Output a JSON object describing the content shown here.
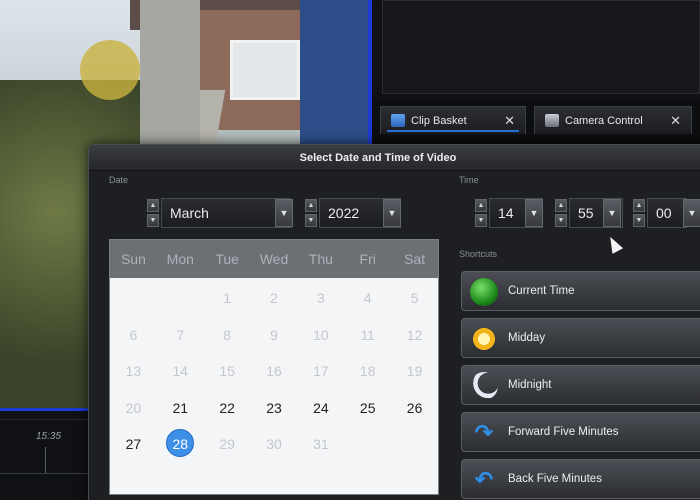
{
  "tabs": [
    {
      "label": "Clip Basket",
      "icon": "clip-basket-icon"
    },
    {
      "label": "Camera Control",
      "icon": "camera-icon"
    }
  ],
  "close_glyph": "✕",
  "timeline": {
    "label": "15:35"
  },
  "dialog": {
    "title": "Select Date and Time of Video",
    "date_group": "Date",
    "time_group": "Time",
    "shortcuts_group": "Shortcuts",
    "month": "March",
    "year": "2022",
    "hour": "14",
    "minute": "55",
    "second": "00"
  },
  "calendar": {
    "weekdays": [
      "Sun",
      "Mon",
      "Tue",
      "Wed",
      "Thu",
      "Fri",
      "Sat"
    ],
    "selected_day": "28",
    "days": [
      {
        "t": "",
        "s": "empty"
      },
      {
        "t": "",
        "s": "empty"
      },
      {
        "t": "1",
        "s": "faded"
      },
      {
        "t": "2",
        "s": "faded"
      },
      {
        "t": "3",
        "s": "faded"
      },
      {
        "t": "4",
        "s": "faded"
      },
      {
        "t": "5",
        "s": "faded"
      },
      {
        "t": "6",
        "s": "faded"
      },
      {
        "t": "7",
        "s": "faded"
      },
      {
        "t": "8",
        "s": "faded"
      },
      {
        "t": "9",
        "s": "faded"
      },
      {
        "t": "10",
        "s": "faded"
      },
      {
        "t": "11",
        "s": "faded"
      },
      {
        "t": "12",
        "s": "faded"
      },
      {
        "t": "13",
        "s": "faded"
      },
      {
        "t": "14",
        "s": "faded"
      },
      {
        "t": "15",
        "s": "faded"
      },
      {
        "t": "16",
        "s": "faded"
      },
      {
        "t": "17",
        "s": "faded"
      },
      {
        "t": "18",
        "s": "faded"
      },
      {
        "t": "19",
        "s": "faded"
      },
      {
        "t": "20",
        "s": "faded"
      },
      {
        "t": "21",
        "s": "normal"
      },
      {
        "t": "22",
        "s": "normal"
      },
      {
        "t": "23",
        "s": "normal"
      },
      {
        "t": "24",
        "s": "normal"
      },
      {
        "t": "25",
        "s": "normal"
      },
      {
        "t": "26",
        "s": "normal"
      },
      {
        "t": "27",
        "s": "normal"
      },
      {
        "t": "28",
        "s": "selected"
      },
      {
        "t": "29",
        "s": "faded"
      },
      {
        "t": "30",
        "s": "faded"
      },
      {
        "t": "31",
        "s": "faded"
      },
      {
        "t": "",
        "s": "empty"
      },
      {
        "t": "",
        "s": "empty"
      }
    ]
  },
  "shortcuts": [
    {
      "label": "Current Time",
      "icon": "green-orb-icon"
    },
    {
      "label": "Midday",
      "icon": "sun-icon"
    },
    {
      "label": "Midnight",
      "icon": "moon-icon"
    },
    {
      "label": "Forward Five Minutes",
      "icon": "forward-arrow-icon"
    },
    {
      "label": "Back Five Minutes",
      "icon": "back-arrow-icon"
    }
  ],
  "colors": {
    "accent": "#3d8fe8",
    "border_blue": "#1e3bd6"
  }
}
